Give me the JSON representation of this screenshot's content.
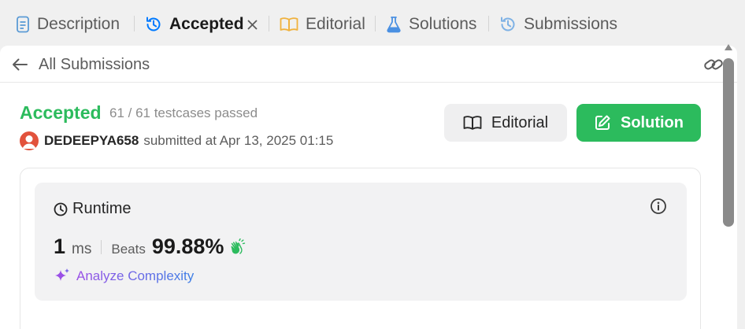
{
  "tabs": [
    {
      "label": "Description",
      "icon": "description-icon"
    },
    {
      "label": "Accepted",
      "icon": "history-icon",
      "active": true
    },
    {
      "label": "Editorial",
      "icon": "book-icon"
    },
    {
      "label": "Solutions",
      "icon": "flask-icon"
    },
    {
      "label": "Submissions",
      "icon": "history-icon"
    }
  ],
  "header": {
    "back_label": "All Submissions"
  },
  "result": {
    "status": "Accepted",
    "testcases": "61 / 61 testcases passed",
    "username": "DEDEEPYA658",
    "submitted_text": "submitted at Apr 13, 2025 01:15"
  },
  "buttons": {
    "editorial": "Editorial",
    "solution": "Solution"
  },
  "runtime": {
    "title": "Runtime",
    "value": "1",
    "unit": "ms",
    "beats_label": "Beats",
    "beats_pct": "99.88%",
    "analyze_label": "Analyze Complexity"
  },
  "colors": {
    "accent_green": "#2cbb5d",
    "active_blue": "#007aff",
    "editorial_yellow": "#f0b23e",
    "solutions_blue": "#4a90e2"
  }
}
